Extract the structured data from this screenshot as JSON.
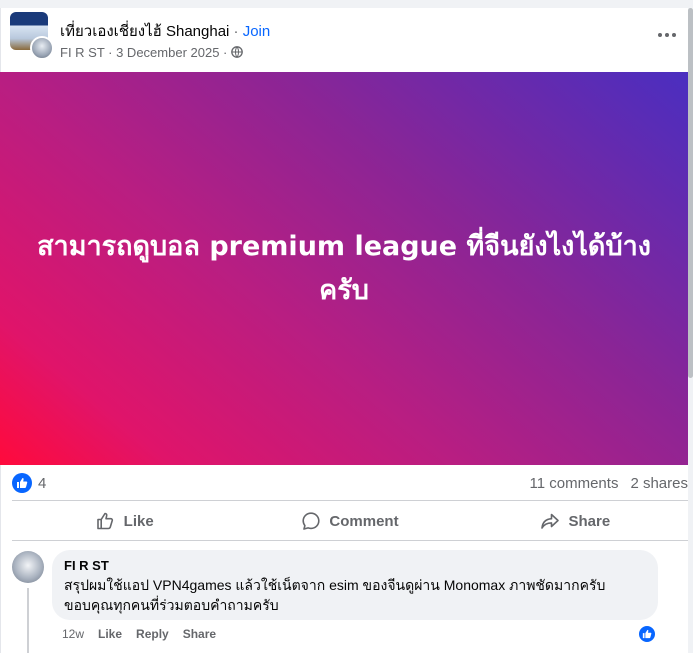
{
  "post": {
    "group_name": "เที่ยวเองเชี่ยงไฮ้ Shanghai",
    "separator": " · ",
    "join_label": "Join",
    "author_date": "FI R ST · 3 December 2025 · ",
    "banner_text": "สามารถดูบอล premium league ที่จีนยังไงได้บ้างครับ"
  },
  "stats": {
    "like_count": "4",
    "comments": "11 comments",
    "shares": "2 shares"
  },
  "actions": {
    "like": "Like",
    "comment": "Comment",
    "share": "Share"
  },
  "comment": {
    "author": "FI R ST",
    "line1": "สรุปผมใช้แอป VPN4games แล้วใช้เน็ตจาก esim ของจีนดูผ่าน Monomax ภาพชัดมากครับ",
    "line2": "ขอบคุณทุกคนที่ร่วมตอบคำถามครับ",
    "time": "12w",
    "like": "Like",
    "reply": "Reply",
    "share": "Share"
  },
  "colors": {
    "accent": "#0866ff",
    "muted_text": "#65676b",
    "banner_gradient": [
      "#ff0a3c",
      "#b81e82",
      "#4a2ec0"
    ]
  },
  "icons": [
    "globe-icon",
    "more-icon",
    "like-reaction-icon",
    "like-icon",
    "comment-icon",
    "share-icon"
  ]
}
